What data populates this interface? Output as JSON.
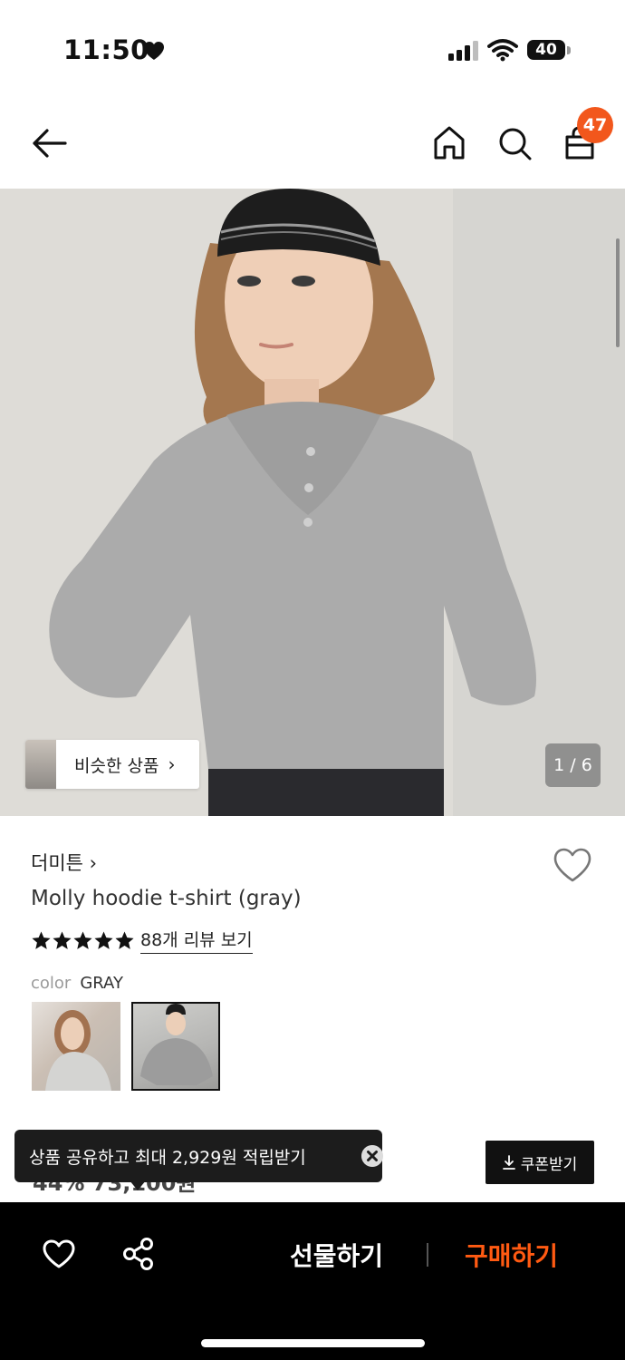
{
  "status_bar": {
    "time": "11:50",
    "battery": "40"
  },
  "header": {
    "cart_count": "47"
  },
  "hero": {
    "similar_label": "비슷한 상품",
    "page_counter": "1 / 6"
  },
  "product": {
    "brand": "더미튼",
    "name": "Molly hoodie t-shirt (gray)",
    "rating_stars": 5,
    "review_link": "88개 리뷰 보기",
    "color_label": "color",
    "color_value": "GRAY",
    "price_peek": "44% 73,100원"
  },
  "share_tooltip": {
    "text": "상품 공유하고 최대 2,929원 적립받기"
  },
  "coupon": {
    "label": "쿠폰받기"
  },
  "bottom_bar": {
    "gift_label": "선물하기",
    "buy_label": "구매하기"
  },
  "colors": {
    "accent": "#f2571c",
    "buy": "#ff5a12",
    "bar": "#000000"
  },
  "icons": [
    "heart-icon",
    "cellular-signal-icon",
    "wifi-icon",
    "battery-icon",
    "back-arrow-icon",
    "home-icon",
    "search-icon",
    "shopping-bag-icon",
    "chevron-right-icon",
    "wishlist-heart-icon",
    "star-icon",
    "close-icon",
    "download-icon",
    "share-icon"
  ]
}
